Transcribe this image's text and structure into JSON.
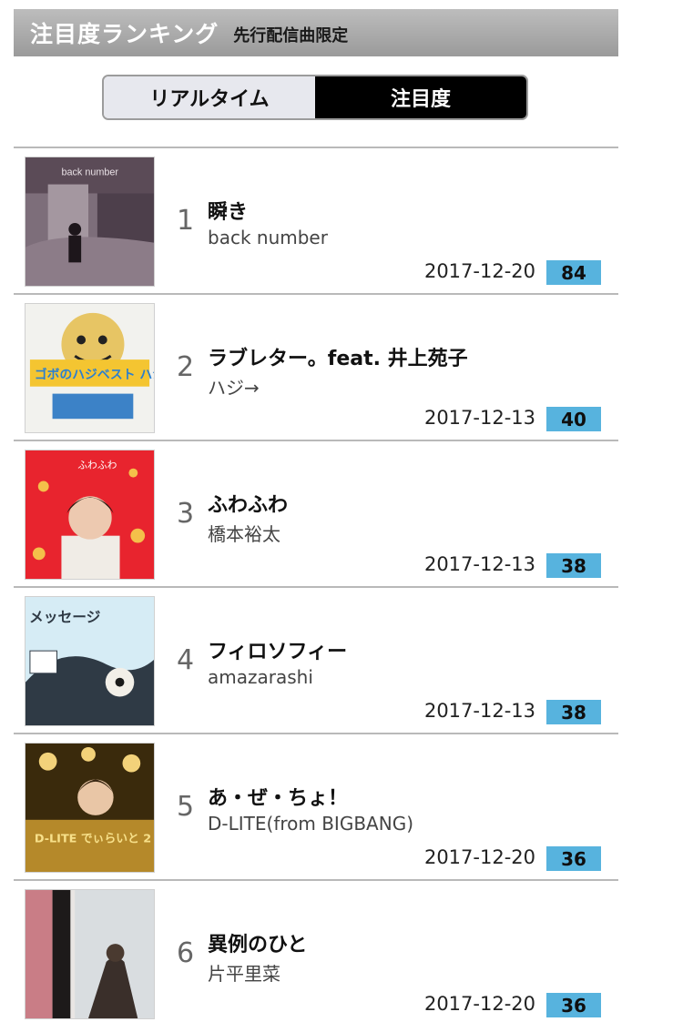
{
  "header": {
    "title": "注目度ランキング",
    "subtitle": "先行配信曲限定"
  },
  "tabs": {
    "realtime": "リアルタイム",
    "attention": "注目度"
  },
  "items": [
    {
      "rank": "1",
      "title": "瞬き",
      "artist": "back number",
      "date": "2017-12-20",
      "score": "84",
      "cover_text": "back number"
    },
    {
      "rank": "2",
      "title": "ラブレター。feat. 井上苑子",
      "artist": "ハジ→",
      "date": "2017-12-13",
      "score": "40",
      "cover_text": "ゴボのハジベスト ハジ→"
    },
    {
      "rank": "3",
      "title": "ふわふわ",
      "artist": "橋本裕太",
      "date": "2017-12-13",
      "score": "38",
      "cover_text": "ふわふわ"
    },
    {
      "rank": "4",
      "title": "フィロソフィー",
      "artist": "amazarashi",
      "date": "2017-12-13",
      "score": "38",
      "cover_text": "メッセージ"
    },
    {
      "rank": "5",
      "title": "あ・ぜ・ちょ！",
      "artist": "D-LITE(from BIGBANG)",
      "date": "2017-12-20",
      "score": "36",
      "cover_text": "D-LITE でぃらいと 2"
    },
    {
      "rank": "6",
      "title": "異例のひと",
      "artist": "片平里菜",
      "date": "2017-12-20",
      "score": "36",
      "cover_text": ""
    }
  ],
  "colors": {
    "score_badge": "#57b3de",
    "header": "#a8a8a8",
    "active_tab": "#000000"
  }
}
